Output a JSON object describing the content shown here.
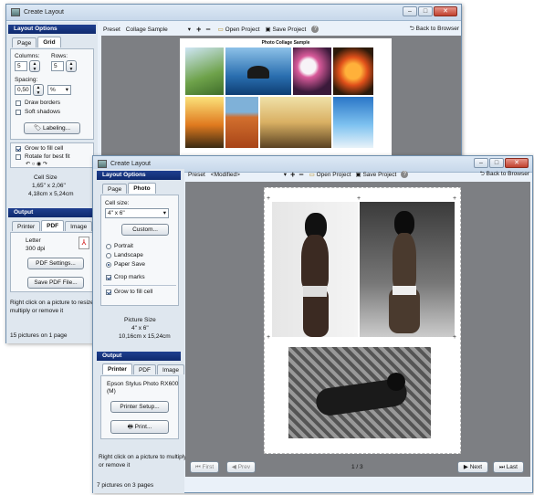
{
  "back_window": {
    "title": "Create Layout",
    "layout_options": "Layout Options",
    "tabs": [
      "Page",
      "Grid"
    ],
    "columns_label": "Columns:",
    "rows_label": "Rows:",
    "columns_value": "5",
    "rows_value": "5",
    "spacing_label": "Spacing:",
    "spacing_value": "0,50",
    "spacing_unit": "%",
    "draw_borders": "Draw borders",
    "soft_shadows": "Soft shadows",
    "labeling_button": "Labeling...",
    "grow_to_fill": "Grow to fill cell",
    "rotate_best_fit": "Rotate for best fit",
    "cell_size_label": "Cell Size",
    "cell_size_in": "1,65\" x 2,06\"",
    "cell_size_cm": "4,18cm x 5,24cm",
    "output_label": "Output",
    "output_tabs": [
      "Printer",
      "PDF",
      "Image"
    ],
    "paper": "Letter",
    "dpi": "300 dpi",
    "pdf_settings_button": "PDF Settings...",
    "save_pdf_button": "Save PDF File...",
    "hint": [
      "Right click on a picture to resize,",
      "multiply or remove it"
    ],
    "status": "15 pictures on 1 page",
    "toolbar": {
      "preset_label": "Preset",
      "preset_value": "Collage Sample",
      "open_project": "Open Project",
      "save_project": "Save Project",
      "back_to_browser": "Back to Browser"
    },
    "page_title": "Photo Collage Sample"
  },
  "front_window": {
    "title": "Create Layout",
    "layout_options": "Layout Options",
    "tabs": [
      "Page",
      "Photo"
    ],
    "cell_size_label": "Cell size:",
    "cell_size_value": "4\" x 6\"",
    "custom_button": "Custom...",
    "orientation": [
      "Portrait",
      "Landscape",
      "Paper Save"
    ],
    "crop_marks": "Crop marks",
    "grow_to_fill": "Grow to fill cell",
    "picture_size_label": "Picture Size",
    "picture_size_in": "4\" x 6\"",
    "picture_size_cm": "10,16cm x 15,24cm",
    "output_label": "Output",
    "output_tabs": [
      "Printer",
      "PDF",
      "Image"
    ],
    "printer_name": [
      "Epson Stylus Photo RX600",
      "(M)"
    ],
    "printer_setup_button": "Printer Setup...",
    "print_button": "Print...",
    "hint": [
      "Right click on a picture to multiply",
      "or remove it"
    ],
    "status": "7 pictures on 3 pages",
    "toolbar": {
      "preset_label": "Preset",
      "preset_value": "<Modified>",
      "open_project": "Open Project",
      "save_project": "Save Project",
      "back_to_browser": "Back to Browser"
    },
    "pager": {
      "first": "First",
      "prev": "Prev",
      "page": "1 / 3",
      "next": "Next",
      "last": "Last"
    }
  },
  "colors": {
    "section_header": "#0f2a6e",
    "canvas": "#7d7f83",
    "window_bg": "#eaf1f9"
  }
}
